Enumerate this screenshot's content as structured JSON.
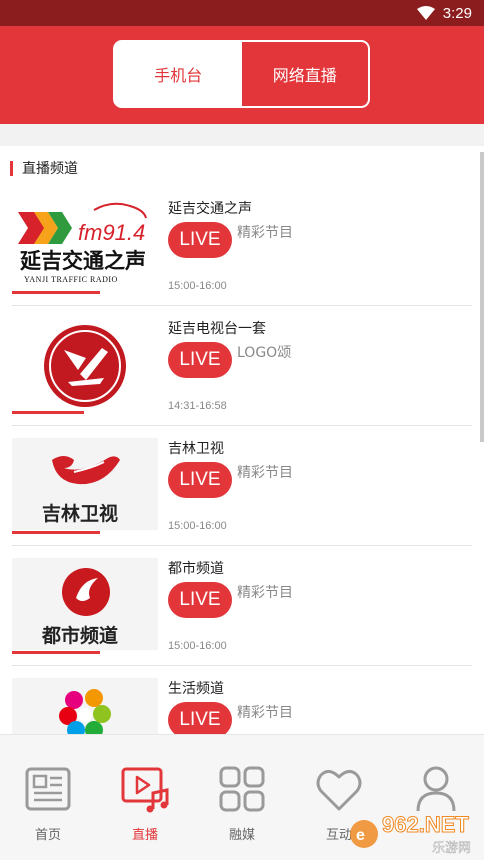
{
  "status_bar": {
    "time": "3:29"
  },
  "segmented": {
    "phone_label": "手机台",
    "network_label": "网络直播",
    "selected": "网络直播"
  },
  "section": {
    "title": "直播频道"
  },
  "live_badge": "LIVE",
  "channels": [
    {
      "name": "延吉交通之声",
      "program": "精彩节目",
      "time": "15:00-16:00",
      "logo": {
        "text": "延吉交通之声",
        "fm": "fm91.4",
        "sub": "YANJI TRAFFIC RADIO"
      }
    },
    {
      "name": "延吉电视台一套",
      "program": "LOGO颂",
      "time": "14:31-16:58"
    },
    {
      "name": "吉林卫视",
      "program": "精彩节目",
      "time": "15:00-16:00",
      "logo": {
        "text": "吉林卫视"
      }
    },
    {
      "name": "都市频道",
      "program": "精彩节目",
      "time": "15:00-16:00",
      "logo": {
        "text": "都市频道"
      }
    },
    {
      "name": "生活频道",
      "program": "精彩节目",
      "time": ""
    }
  ],
  "tabs": [
    {
      "label": "首页",
      "icon": "news-icon"
    },
    {
      "label": "直播",
      "icon": "play-music-icon",
      "active": true
    },
    {
      "label": "融媒",
      "icon": "grid-icon"
    },
    {
      "label": "互动",
      "icon": "heart-icon"
    },
    {
      "label": "",
      "icon": "user-icon"
    }
  ],
  "watermark": {
    "text": "962.NET",
    "sub": "乐游网"
  },
  "colors": {
    "accent": "#e3363a",
    "statusbar": "#8c1d1f"
  }
}
